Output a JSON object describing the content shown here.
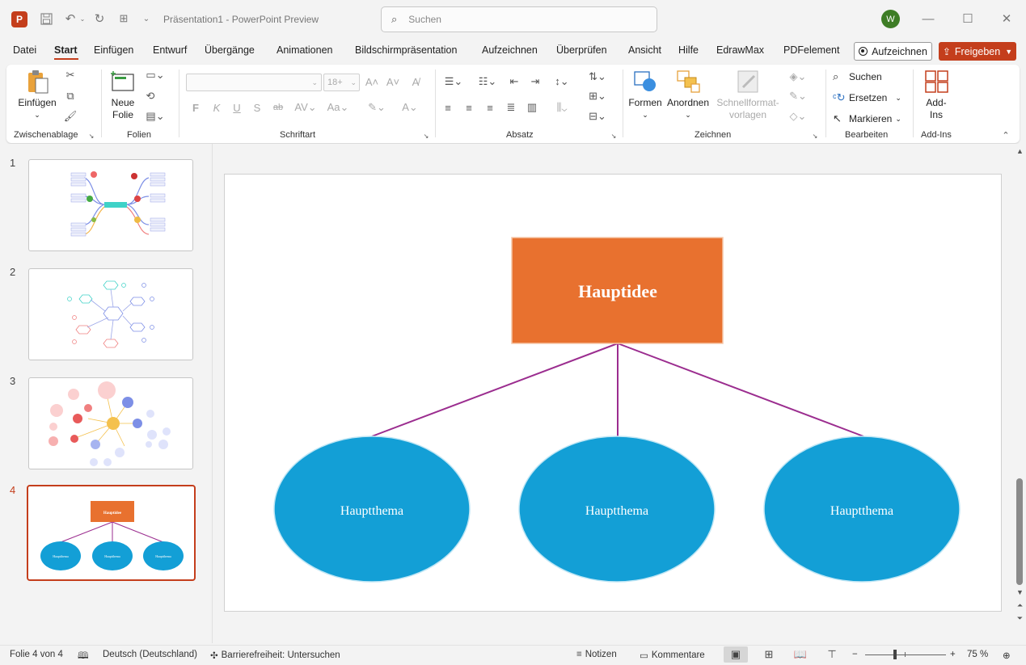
{
  "titlebar": {
    "app_icon_letter": "P",
    "document_title": "Präsentation1  -  PowerPoint Preview",
    "search_placeholder": "Suchen",
    "user_initial": "W"
  },
  "menu": {
    "items": [
      "Datei",
      "Start",
      "Einfügen",
      "Entwurf",
      "Übergänge",
      "Animationen",
      "Bildschirmpräsentation",
      "Aufzeichnen",
      "Überprüfen",
      "Ansicht",
      "Hilfe",
      "EdrawMax",
      "PDFelement"
    ],
    "active": "Start",
    "record_label": "Aufzeichnen",
    "share_label": "Freigeben"
  },
  "ribbon": {
    "clipboard": {
      "paste_label": "Einfügen",
      "group_label": "Zwischenablage"
    },
    "slides": {
      "new_slide_label_1": "Neue",
      "new_slide_label_2": "Folie",
      "group_label": "Folien"
    },
    "font": {
      "size_value": "18+",
      "bold": "F",
      "italic": "K",
      "underline": "U",
      "shadow": "S",
      "strike": "ab",
      "group_label": "Schriftart"
    },
    "paragraph": {
      "group_label": "Absatz"
    },
    "drawing": {
      "shapes_label": "Formen",
      "arrange_label": "Anordnen",
      "quickstyles_label_1": "Schnellformat-",
      "quickstyles_label_2": "vorlagen",
      "group_label": "Zeichnen"
    },
    "editing": {
      "find_label": "Suchen",
      "replace_label": "Ersetzen",
      "select_label": "Markieren",
      "group_label": "Bearbeiten"
    },
    "addins": {
      "label_1": "Add-",
      "label_2": "Ins",
      "group_label": "Add-Ins"
    }
  },
  "thumbnails": {
    "numbers": [
      "1",
      "2",
      "3",
      "4"
    ],
    "active_index": 4,
    "slide4_main": "Hauptidee",
    "slide4_topics": [
      "Hauptthema",
      "Hauptthema",
      "Hauptthema"
    ]
  },
  "slide": {
    "main_idea": "Hauptidee",
    "topics": [
      "Hauptthema",
      "Hauptthema",
      "Hauptthema"
    ],
    "colors": {
      "main_box": "#e8712f",
      "topic_ellipse": "#139fd6",
      "connector": "#9b2d8f"
    }
  },
  "status": {
    "slide_counter": "Folie 4 von 4",
    "language": "Deutsch (Deutschland)",
    "accessibility": "Barrierefreiheit: Untersuchen",
    "notes_label": "Notizen",
    "comments_label": "Kommentare",
    "zoom_minus": "−",
    "zoom_plus": "+",
    "zoom_level": "75 %"
  }
}
